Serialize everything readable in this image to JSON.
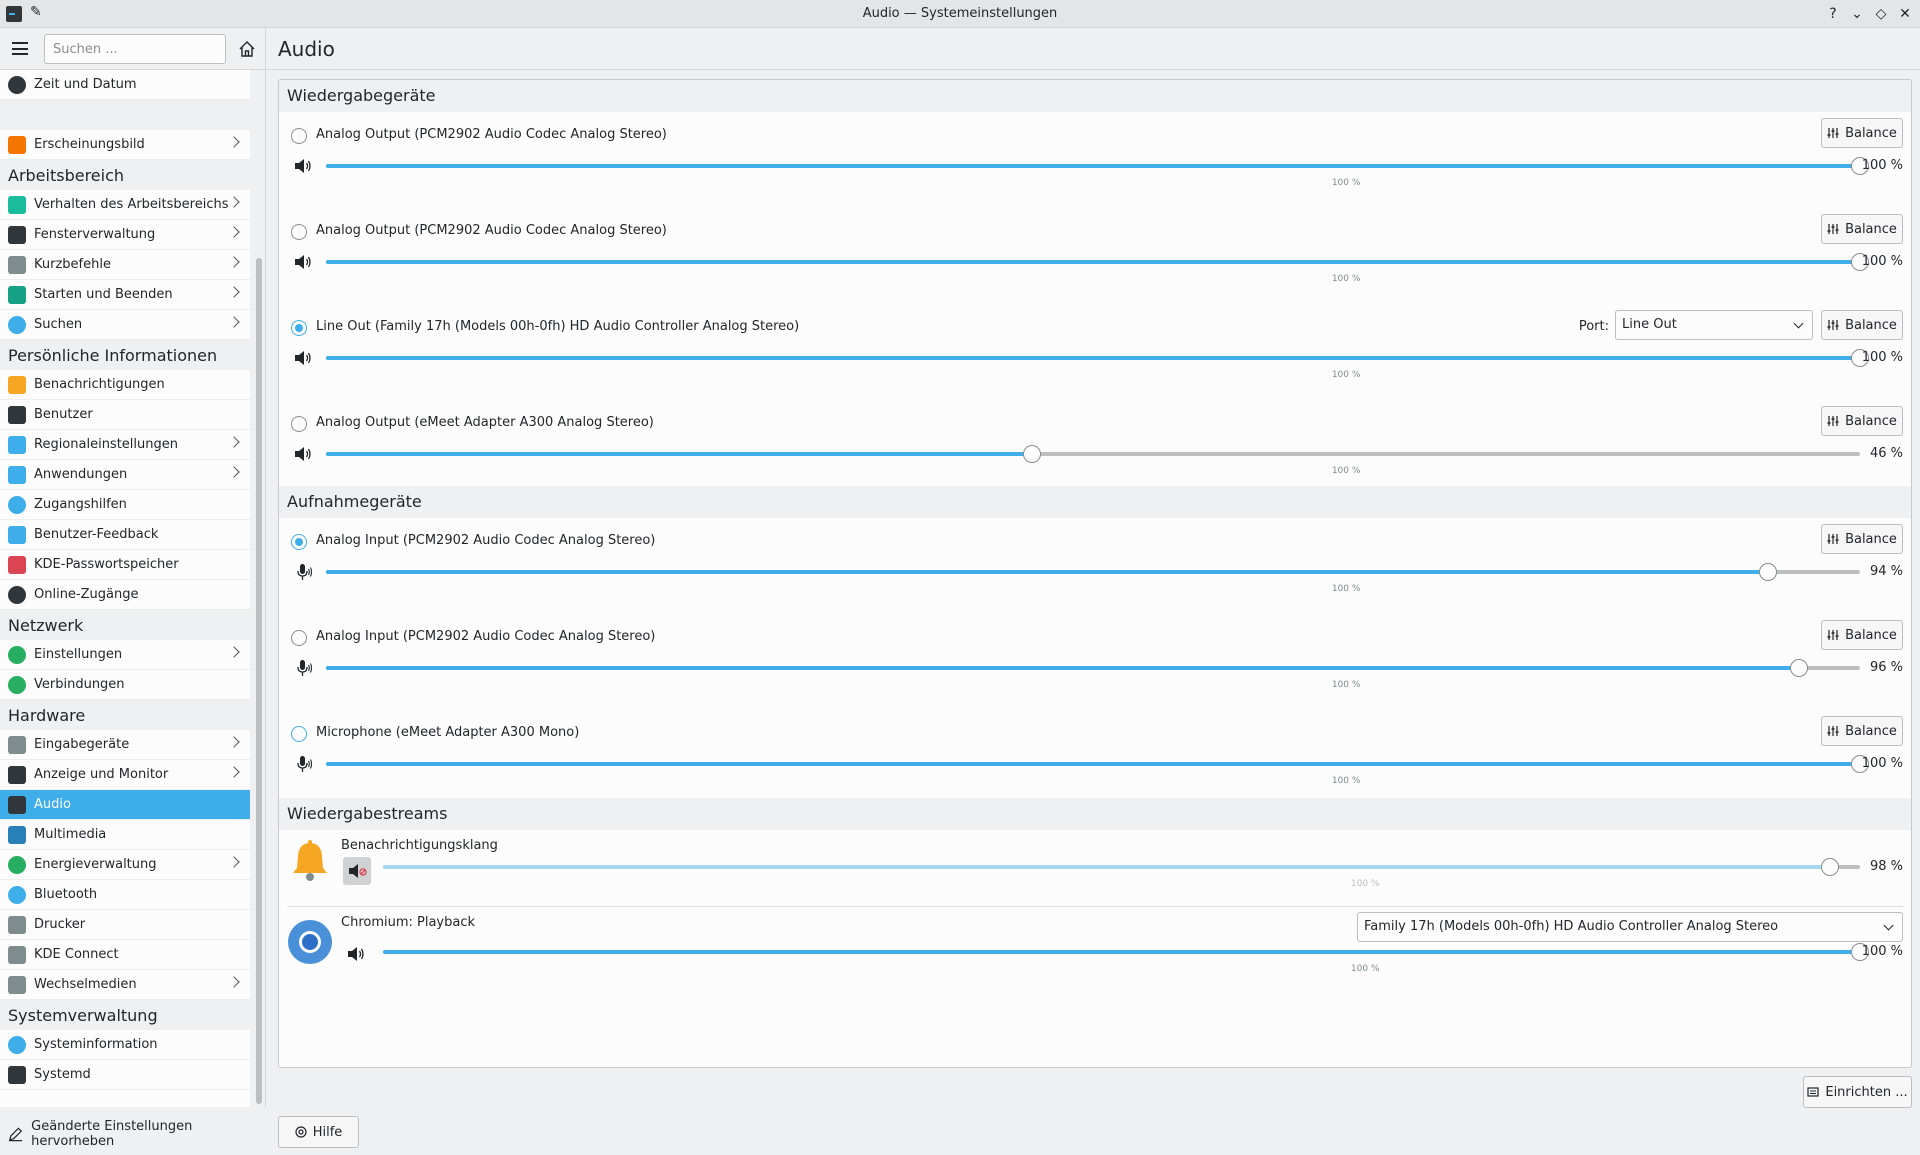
{
  "window": {
    "title": "Audio — Systemeinstellungen",
    "controls": [
      "?",
      "⌄",
      "◇",
      "✕"
    ]
  },
  "search": {
    "placeholder": "Suchen ..."
  },
  "page_title": "Audio",
  "sidebar": [
    {
      "kind": "item",
      "label": "Zeit und Datum",
      "icon": "clock-icon",
      "color": "#31363b",
      "chevron": false
    },
    {
      "kind": "gap"
    },
    {
      "kind": "item",
      "label": "Erscheinungsbild",
      "icon": "appearance-icon",
      "color": "#f67400",
      "chevron": true
    },
    {
      "kind": "category",
      "label": "Arbeitsbereich"
    },
    {
      "kind": "item",
      "label": "Verhalten des Arbeitsbereichs",
      "icon": "workspace-icon",
      "color": "#1abc9c",
      "chevron": true
    },
    {
      "kind": "item",
      "label": "Fensterverwaltung",
      "icon": "window-icon",
      "color": "#31363b",
      "chevron": true
    },
    {
      "kind": "item",
      "label": "Kurzbefehle",
      "icon": "keyboard-icon",
      "color": "#7f8c8d",
      "chevron": true
    },
    {
      "kind": "item",
      "label": "Starten und Beenden",
      "icon": "startup-icon",
      "color": "#16a085",
      "chevron": true
    },
    {
      "kind": "item",
      "label": "Suchen",
      "icon": "search-icon",
      "color": "#3daee9",
      "chevron": true
    },
    {
      "kind": "category",
      "label": "Persönliche Informationen"
    },
    {
      "kind": "item",
      "label": "Benachrichtigungen",
      "icon": "bell-icon",
      "color": "#f5a623",
      "chevron": false
    },
    {
      "kind": "item",
      "label": "Benutzer",
      "icon": "user-icon",
      "color": "#31363b",
      "chevron": false
    },
    {
      "kind": "item",
      "label": "Regionaleinstellungen",
      "icon": "region-icon",
      "color": "#3daee9",
      "chevron": true
    },
    {
      "kind": "item",
      "label": "Anwendungen",
      "icon": "apps-icon",
      "color": "#3daee9",
      "chevron": true
    },
    {
      "kind": "item",
      "label": "Zugangshilfen",
      "icon": "accessibility-icon",
      "color": "#3daee9",
      "chevron": false
    },
    {
      "kind": "item",
      "label": "Benutzer-Feedback",
      "icon": "feedback-icon",
      "color": "#3daee9",
      "chevron": false
    },
    {
      "kind": "item",
      "label": "KDE-Passwortspeicher",
      "icon": "wallet-icon",
      "color": "#da4453",
      "chevron": false
    },
    {
      "kind": "item",
      "label": "Online-Zugänge",
      "icon": "globe-icon",
      "color": "#31363b",
      "chevron": false
    },
    {
      "kind": "category",
      "label": "Netzwerk"
    },
    {
      "kind": "item",
      "label": "Einstellungen",
      "icon": "network-icon",
      "color": "#27ae60",
      "chevron": true
    },
    {
      "kind": "item",
      "label": "Verbindungen",
      "icon": "connections-icon",
      "color": "#27ae60",
      "chevron": false
    },
    {
      "kind": "category",
      "label": "Hardware"
    },
    {
      "kind": "item",
      "label": "Eingabegeräte",
      "icon": "input-devices-icon",
      "color": "#7f8c8d",
      "chevron": true
    },
    {
      "kind": "item",
      "label": "Anzeige und Monitor",
      "icon": "monitor-icon",
      "color": "#31363b",
      "chevron": true
    },
    {
      "kind": "item",
      "label": "Audio",
      "icon": "audio-icon",
      "color": "#31363b",
      "chevron": false,
      "active": true
    },
    {
      "kind": "item",
      "label": "Multimedia",
      "icon": "multimedia-icon",
      "color": "#2980b9",
      "chevron": false
    },
    {
      "kind": "item",
      "label": "Energieverwaltung",
      "icon": "power-icon",
      "color": "#27ae60",
      "chevron": true
    },
    {
      "kind": "item",
      "label": "Bluetooth",
      "icon": "bluetooth-icon",
      "color": "#3daee9",
      "chevron": false
    },
    {
      "kind": "item",
      "label": "Drucker",
      "icon": "printer-icon",
      "color": "#7f8c8d",
      "chevron": false
    },
    {
      "kind": "item",
      "label": "KDE Connect",
      "icon": "phone-icon",
      "color": "#7f8c8d",
      "chevron": false
    },
    {
      "kind": "item",
      "label": "Wechselmedien",
      "icon": "usb-icon",
      "color": "#7f8c8d",
      "chevron": true
    },
    {
      "kind": "category",
      "label": "Systemverwaltung"
    },
    {
      "kind": "item",
      "label": "Systeminformation",
      "icon": "info-icon",
      "color": "#3daee9",
      "chevron": false
    },
    {
      "kind": "item",
      "label": "Systemd",
      "icon": "systemd-icon",
      "color": "#31363b",
      "chevron": false
    }
  ],
  "highlight_changed": "Geänderte Einstellungen hervorheben",
  "sections": {
    "playback": "Wiedergabegeräte",
    "recording": "Aufnahmegeräte",
    "streams": "Wiedergabestreams"
  },
  "balance_label": "Balance",
  "port_label": "Port:",
  "playback_devices": [
    {
      "name": "Analog Output (PCM2902 Audio Codec Analog Stereo)",
      "selected": false,
      "volume": 100,
      "volume_text": "100 %",
      "tick_text": "100 %",
      "port": null
    },
    {
      "name": "Analog Output (PCM2902 Audio Codec Analog Stereo)",
      "selected": false,
      "volume": 100,
      "volume_text": "100 %",
      "tick_text": "100 %",
      "port": null
    },
    {
      "name": "Line Out (Family 17h (Models 00h-0fh) HD Audio Controller Analog Stereo)",
      "selected": true,
      "volume": 100,
      "volume_text": "100 %",
      "tick_text": "100 %",
      "port": "Line Out"
    },
    {
      "name": "Analog Output (eMeet Adapter A300 Analog Stereo)",
      "selected": false,
      "volume": 46,
      "volume_text": "46 %",
      "tick_text": "100 %",
      "port": null
    }
  ],
  "recording_devices": [
    {
      "name": "Analog Input (PCM2902 Audio Codec Analog Stereo)",
      "selected": true,
      "volume": 94,
      "volume_text": "94 %",
      "tick_text": "100 %"
    },
    {
      "name": "Analog Input (PCM2902 Audio Codec Analog Stereo)",
      "selected": false,
      "volume": 96,
      "volume_text": "96 %",
      "tick_text": "100 %"
    },
    {
      "name": "Microphone (eMeet Adapter A300 Mono)",
      "selected": false,
      "volume": 100,
      "volume_text": "100 %",
      "tick_text": "100 %"
    }
  ],
  "streams": [
    {
      "name": "Benachrichtigungsklang",
      "volume": 98,
      "volume_text": "98 %",
      "tick_text": "100 %",
      "muted": true,
      "app_icon": "bell-icon",
      "device": null
    },
    {
      "name": "Chromium: Playback",
      "volume": 100,
      "volume_text": "100 %",
      "tick_text": "100 %",
      "muted": false,
      "app_icon": "chromium-icon",
      "device": "Family 17h (Models 00h-0fh) HD Audio Controller Analog Stereo"
    }
  ],
  "buttons": {
    "configure": "Einrichten ...",
    "help": "Hilfe"
  },
  "colors": {
    "accent": "#3daee9",
    "track": "#bcbebf"
  }
}
